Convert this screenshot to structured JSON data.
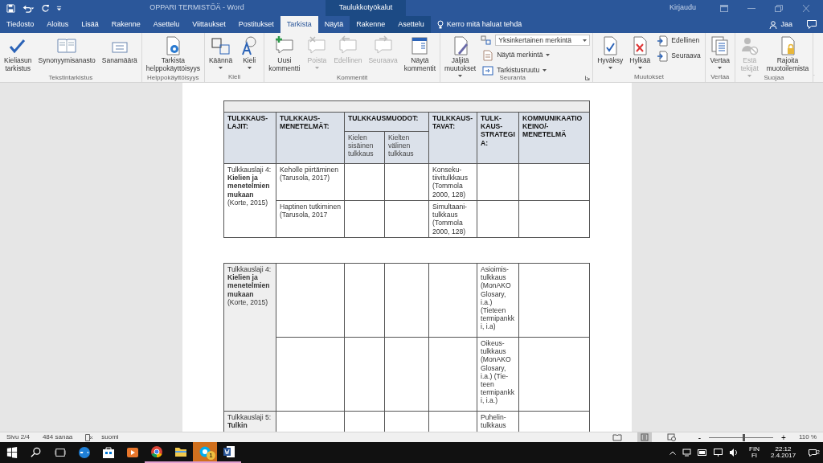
{
  "title_bar": {
    "title": "OPPARI TERMISTÖÄ  -  Word",
    "context": "Taulukkotyökalut",
    "sign_in": "Kirjaudu"
  },
  "tabs": [
    {
      "label": "Tiedosto",
      "selected": false,
      "contextual": false
    },
    {
      "label": "Aloitus",
      "selected": false,
      "contextual": false
    },
    {
      "label": "Lisää",
      "selected": false,
      "contextual": false
    },
    {
      "label": "Rakenne",
      "selected": false,
      "contextual": false
    },
    {
      "label": "Asettelu",
      "selected": false,
      "contextual": false
    },
    {
      "label": "Viittaukset",
      "selected": false,
      "contextual": false
    },
    {
      "label": "Postitukset",
      "selected": false,
      "contextual": false
    },
    {
      "label": "Tarkista",
      "selected": true,
      "contextual": false
    },
    {
      "label": "Näytä",
      "selected": false,
      "contextual": false
    },
    {
      "label": "Rakenne",
      "selected": false,
      "contextual": true
    },
    {
      "label": "Asettelu",
      "selected": false,
      "contextual": true
    }
  ],
  "tell_me": "Kerro mitä haluat tehdä",
  "share": "Jaa",
  "ribbon": [
    {
      "label": "Tekstintarkistus",
      "launcher": false,
      "commands": [
        {
          "kind": "large",
          "label": "Kieliasun\ntarkistus",
          "disabled": false,
          "dropdown": false
        },
        {
          "kind": "large",
          "label": "Synonyymisanasto",
          "disabled": false,
          "dropdown": false
        },
        {
          "kind": "large",
          "label": "Sanamäärä",
          "disabled": false,
          "dropdown": false
        }
      ]
    },
    {
      "label": "Helppokäyttöisyys",
      "launcher": false,
      "commands": [
        {
          "kind": "large",
          "label": "Tarkista\nhelppokäyttöisyys",
          "disabled": false,
          "dropdown": false
        }
      ]
    },
    {
      "label": "Kieli",
      "launcher": false,
      "commands": [
        {
          "kind": "large",
          "label": "Käännä",
          "disabled": false,
          "dropdown": true
        },
        {
          "kind": "large",
          "label": "Kieli",
          "disabled": false,
          "dropdown": true
        }
      ]
    },
    {
      "label": "Kommentit",
      "launcher": false,
      "commands": [
        {
          "kind": "large",
          "label": "Uusi\nkommentti",
          "disabled": false,
          "dropdown": false
        },
        {
          "kind": "large",
          "label": "Poista",
          "disabled": true,
          "dropdown": true
        },
        {
          "kind": "large",
          "label": "Edellinen",
          "disabled": true,
          "dropdown": false
        },
        {
          "kind": "large",
          "label": "Seuraava",
          "disabled": true,
          "dropdown": false
        },
        {
          "kind": "large",
          "label": "Näytä\nkommentit",
          "disabled": false,
          "dropdown": false
        }
      ]
    },
    {
      "label": "Seuranta",
      "launcher": true,
      "commands": [
        {
          "kind": "large",
          "label": "Jäljitä\nmuutokset",
          "disabled": false,
          "dropdown": true
        },
        {
          "kind": "select",
          "label": "Yksinkertainen merkintä",
          "disabled": false,
          "dropdown": true
        },
        {
          "kind": "small",
          "label": "Näytä merkintä",
          "disabled": false,
          "dropdown": true
        },
        {
          "kind": "small",
          "label": "Tarkistusruutu",
          "disabled": false,
          "dropdown": true
        }
      ]
    },
    {
      "label": "Muutokset",
      "launcher": false,
      "commands": [
        {
          "kind": "large",
          "label": "Hyväksy",
          "disabled": false,
          "dropdown": true
        },
        {
          "kind": "large",
          "label": "Hylkää",
          "disabled": false,
          "dropdown": true
        },
        {
          "kind": "small",
          "label": "Edellinen",
          "disabled": false,
          "dropdown": false
        },
        {
          "kind": "small",
          "label": "Seuraava",
          "disabled": false,
          "dropdown": false
        }
      ]
    },
    {
      "label": "Vertaa",
      "launcher": false,
      "commands": [
        {
          "kind": "large",
          "label": "Vertaa",
          "disabled": false,
          "dropdown": true
        }
      ]
    },
    {
      "label": "Suojaa",
      "launcher": false,
      "commands": [
        {
          "kind": "large",
          "label": "Estä\ntekijät",
          "disabled": true,
          "dropdown": true
        },
        {
          "kind": "large",
          "label": "Rajoita\nmuotoilemista",
          "disabled": false,
          "dropdown": false
        }
      ]
    }
  ],
  "document": {
    "tables": [
      {
        "columns": [
          {
            "label": "TULKKAUS-LAJIT:"
          },
          {
            "label": "TULKKAUS-MENETELMÄT:"
          },
          {
            "label": "TULKKAUSMUODOT:",
            "subcolumns": [
              "Kielen sisäinen tulkkaus",
              "Kielten välinen tulkkaus"
            ]
          },
          {
            "label": "TULKKAUS-TAVAT:"
          },
          {
            "label": "TULK-KAUS-STRATEGIA:"
          },
          {
            "label": "KOMMUNIKAATIOKEINO/-MENETELMÄ"
          }
        ],
        "groups": [
          {
            "heading": "Tulkkauslaji 4: **Kielien ja menetelmien mukaan** (Korte, 2015)",
            "rows": [
              {
                "method": "Keholle piirtäminen (Tarusola, 2017)",
                "manner": "Konseku-tiivitulkkaus (Tommola 2000, 128)"
              },
              {
                "method": "Haptinen tutkiminen (Tarusola, 2017",
                "manner": "Simultaani-tulkkaus (Tommola 2000, 128)"
              }
            ]
          }
        ]
      },
      {
        "groups": [
          {
            "heading": "Tulkkauslaji 4: **Kielien ja menetelmien mukaan** (Korte, 2015)",
            "rows": [
              {
                "strategy": "Asioimis-tulkkaus (MonAKO Glosary, i.a.) (Tieteen termipankki, i.a)"
              },
              {
                "strategy": "Oikeus-tulkkaus (MonAKO Glosary, i.a.) (Tie-teen termipankki, i.a.)"
              }
            ]
          },
          {
            "heading": "Tulkkauslaji 5: **Tulkin**",
            "rows": [
              {
                "strategy": "Puhelin-tulkkaus"
              }
            ]
          }
        ]
      }
    ]
  },
  "status_bar": {
    "page": "Sivu 2/4",
    "words": "484 sanaa",
    "language": "suomi",
    "views": [
      {
        "selected": false
      },
      {
        "selected": true
      },
      {
        "selected": false
      }
    ],
    "zoom_out": "-",
    "zoom_in": "+",
    "zoom": {
      "level": 0.54
    },
    "zoom_reading": "110 %"
  },
  "taskbar": {
    "apps": [
      {
        "running": false,
        "attention": false
      },
      {
        "running": false,
        "attention": false
      },
      {
        "running": false,
        "attention": false
      },
      {
        "running": true,
        "attention": false
      },
      {
        "running": true,
        "attention": false
      },
      {
        "running": true,
        "attention": true,
        "badge": "1"
      },
      {
        "running": true,
        "attention": false
      }
    ],
    "keyboard": [
      "FIN",
      "FI"
    ],
    "time": "22:12",
    "date": "2.4.2017",
    "notifications": "2"
  }
}
